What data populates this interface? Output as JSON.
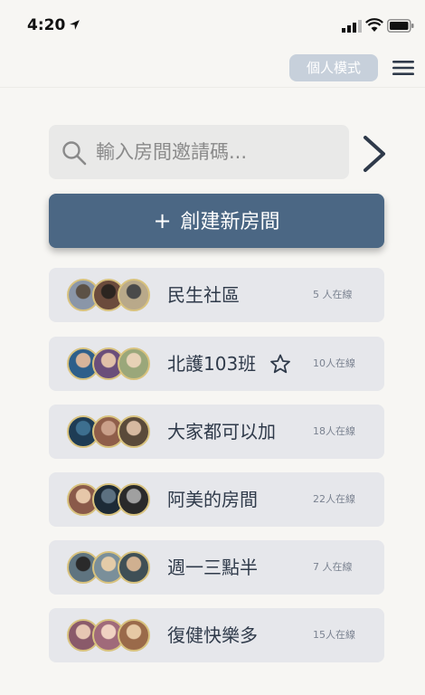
{
  "status_bar": {
    "time": "4:20"
  },
  "header": {
    "mode_label": "個人模式"
  },
  "search": {
    "placeholder": "輸入房間邀請碼..."
  },
  "create": {
    "plus": "+",
    "label": "創建新房間"
  },
  "rooms": [
    {
      "name": "民生社區",
      "count": "5 人在線",
      "starred": false,
      "avatars": [
        [
          "#8a96a8",
          "#5c5146"
        ],
        [
          "#6b4b3c",
          "#2c2520"
        ],
        [
          "#b9a98a",
          "#4a4a4a"
        ]
      ]
    },
    {
      "name": "北護103班",
      "count": "10人在線",
      "starred": true,
      "avatars": [
        [
          "#2e5f8a",
          "#d7b49a"
        ],
        [
          "#6a4e7a",
          "#e0c0a8"
        ],
        [
          "#9aa77a",
          "#e7d2b6"
        ]
      ]
    },
    {
      "name": "大家都可以加",
      "count": "18人在線",
      "starred": false,
      "avatars": [
        [
          "#1e3c55",
          "#3d6f8f"
        ],
        [
          "#8f5e4a",
          "#caa08a"
        ],
        [
          "#5a4a3a",
          "#d6b9a0"
        ]
      ]
    },
    {
      "name": "阿美的房間",
      "count": "22人在線",
      "starred": false,
      "avatars": [
        [
          "#8a5a4a",
          "#e6c7a9"
        ],
        [
          "#1d2a36",
          "#5c7080"
        ],
        [
          "#2a2a2a",
          "#a0a0a0"
        ]
      ]
    },
    {
      "name": "週一三點半",
      "count": "7 人在線",
      "starred": false,
      "avatars": [
        [
          "#5f7480",
          "#2a2a2a"
        ],
        [
          "#7a8f9a",
          "#e3cba8"
        ],
        [
          "#3f4f56",
          "#d0b090"
        ]
      ]
    },
    {
      "name": "復健快樂多",
      "count": "15人在線",
      "starred": false,
      "avatars": [
        [
          "#8a5a6a",
          "#e7c7b3"
        ],
        [
          "#a06a7a",
          "#f0d2c2"
        ],
        [
          "#9a6a4a",
          "#e6c9a4"
        ]
      ]
    }
  ]
}
